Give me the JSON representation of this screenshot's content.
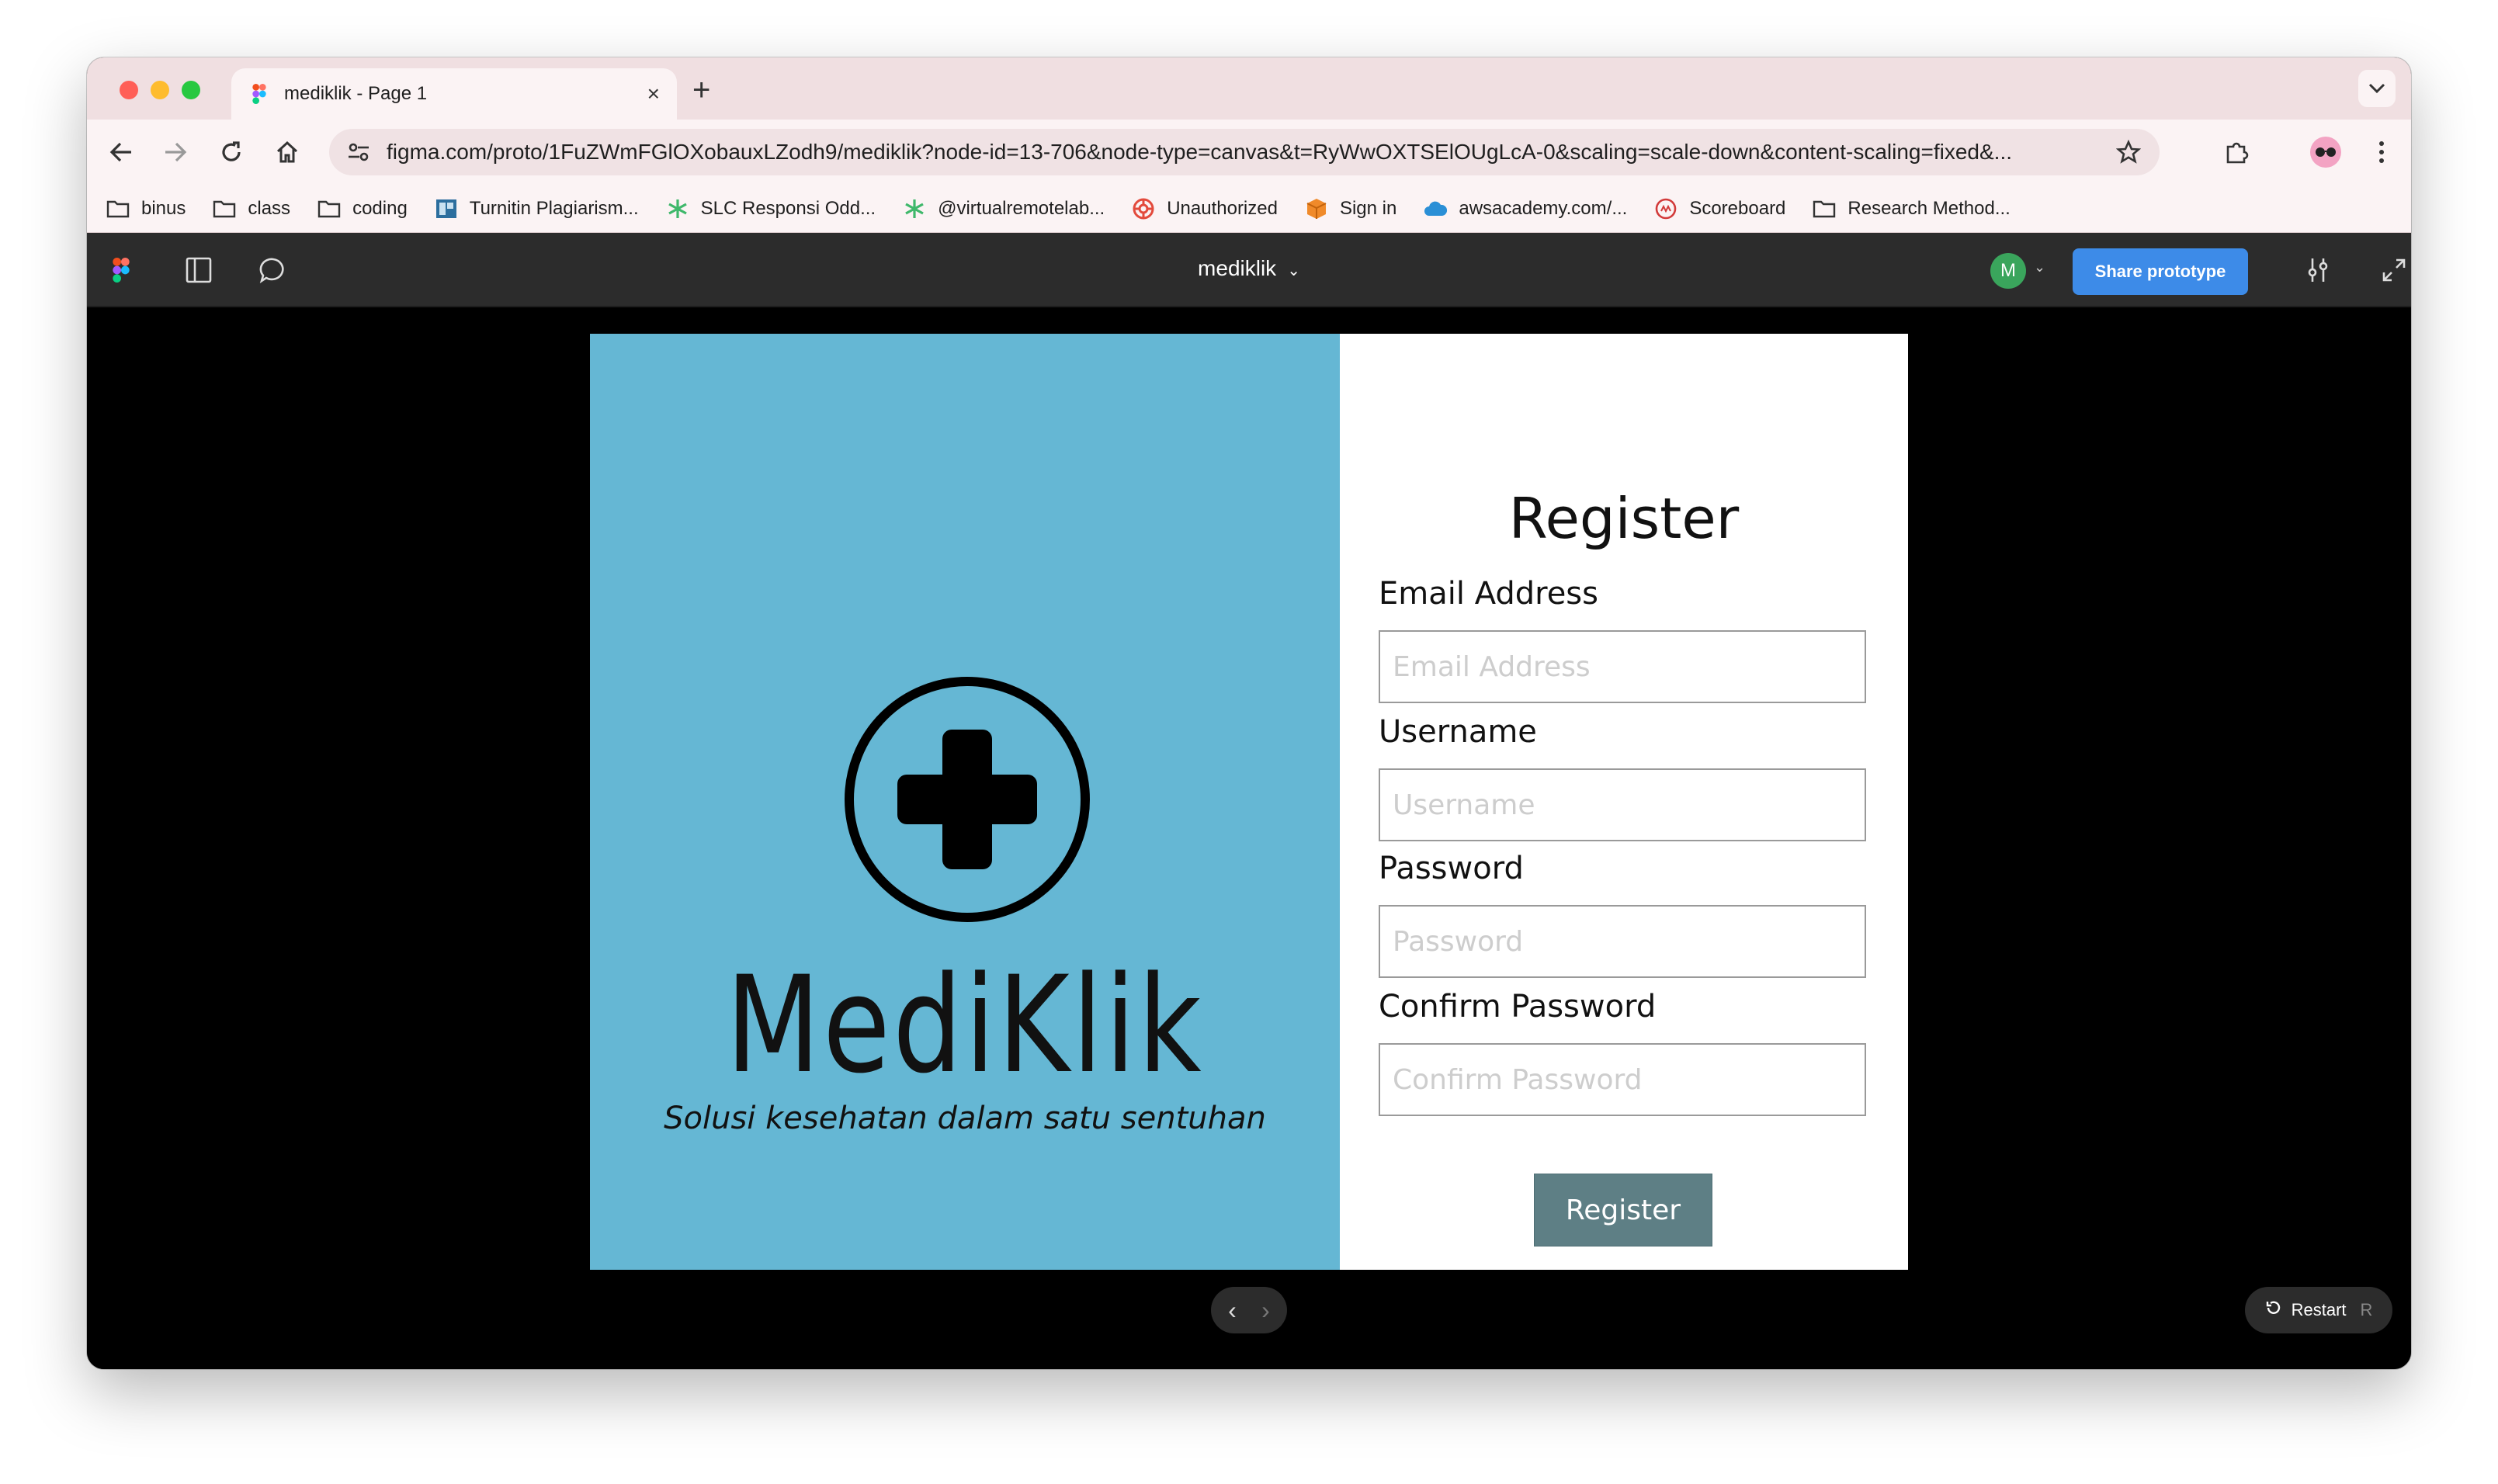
{
  "browser": {
    "tab_title": "mediklik - Page 1",
    "tab_close": "×",
    "new_tab": "+",
    "url": "figma.com/proto/1FuZWmFGlOXobauxLZodh9/mediklik?node-id=13-706&node-type=canvas&t=RyWwOXTSElOUgLcA-0&scaling=scale-down&content-scaling=fixed&...",
    "bookmarks": [
      {
        "label": "binus",
        "icon": "folder-icon"
      },
      {
        "label": "class",
        "icon": "folder-icon"
      },
      {
        "label": "coding",
        "icon": "folder-icon"
      },
      {
        "label": "Turnitin Plagiarism...",
        "icon": "turnitin-icon"
      },
      {
        "label": "SLC Responsi Odd...",
        "icon": "asterisk-icon"
      },
      {
        "label": "@virtualremotelab...",
        "icon": "asterisk-icon"
      },
      {
        "label": "Unauthorized",
        "icon": "lifebuoy-icon"
      },
      {
        "label": "Sign in",
        "icon": "box-icon"
      },
      {
        "label": "awsacademy.com/...",
        "icon": "cloud-icon"
      },
      {
        "label": "Scoreboard",
        "icon": "ctf-icon"
      },
      {
        "label": "Research Method...",
        "icon": "folder-icon"
      }
    ]
  },
  "figma": {
    "file_title": "mediklik",
    "avatar_initial": "M",
    "share_label": "Share prototype",
    "restart_label": "Restart",
    "restart_key": "R"
  },
  "prototype": {
    "brand": "MediKlik",
    "tagline": "Solusi kesehatan dalam satu sentuhan",
    "form_title": "Register",
    "fields": {
      "email": {
        "label": "Email Address",
        "placeholder": "Email Address"
      },
      "username": {
        "label": "Username",
        "placeholder": "Username"
      },
      "password": {
        "label": "Password",
        "placeholder": "Password"
      },
      "confirm": {
        "label": "Confirm Password",
        "placeholder": "Confirm Password"
      }
    },
    "submit_label": "Register",
    "colors": {
      "left_panel": "#65b7d4",
      "button": "#5e7f85"
    }
  }
}
